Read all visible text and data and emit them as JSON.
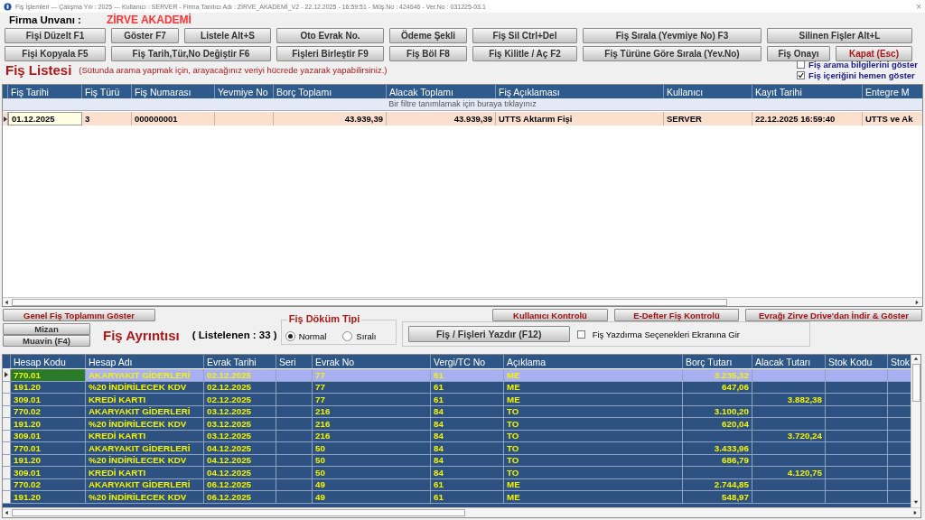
{
  "window": {
    "title": "Fiş İşlemleri  ---  Çalışma Yılı : 2025  ---  Kullanıcı : SERVER - Firma Tanıtıcı Adı : ZİRVE_AKADEMİ_V2 - 22.12.2025 - 16:59:51 - Müş.No : 424646 - Ver.No : 031225-03.1",
    "close": "×"
  },
  "firm": {
    "label": "Firma  Unvanı :",
    "value": "ZİRVE AKADEMİ"
  },
  "toolbar": [
    {
      "label": "Fişi Düzelt F1",
      "kind": "normal"
    },
    {
      "label": "Göster F7",
      "kind": "normal"
    },
    {
      "label": "Listele Alt+S",
      "kind": "normal"
    },
    {
      "label": "Oto Evrak No.",
      "kind": "normal"
    },
    {
      "label": "Ödeme Şekli",
      "kind": "normal"
    },
    {
      "label": "Fiş Sil Ctrl+Del",
      "kind": "normal"
    },
    {
      "label": "Fiş Sırala (Yevmiye No) F3",
      "kind": "normal"
    },
    {
      "label": "Silinen Fişler Alt+L",
      "kind": "normal"
    },
    {
      "label": "Fişi Kopyala F5",
      "kind": "normal"
    },
    {
      "label": "Fiş Tarih,Tür,No Değiştir F6",
      "kind": "normal"
    },
    {
      "label": "Fişleri Birleştir F9",
      "kind": "normal"
    },
    {
      "label": "Fiş Böl F8",
      "kind": "normal"
    },
    {
      "label": "Fiş Kilitle / Aç F2",
      "kind": "normal"
    },
    {
      "label": "Fiş Türüne Göre Sırala (Yev.No)",
      "kind": "normal"
    },
    {
      "label": "Fiş Onayı",
      "kind": "normal"
    },
    {
      "label": "Kapat (Esc)",
      "kind": "close"
    }
  ],
  "list_section": {
    "title": "Fiş Listesi",
    "hint": "(Sütunda arama yapmak için, arayacağınız veriyi hücrede yazarak yapabilirsiniz.)",
    "options": [
      {
        "label": "Fiş arama bilgilerini göster",
        "checked": false
      },
      {
        "label": "Fiş içeriğini hemen göster",
        "checked": true
      }
    ]
  },
  "voucher_table": {
    "columns": [
      {
        "label": "Fiş Tarihi"
      },
      {
        "label": "Fiş Türü"
      },
      {
        "label": "Fiş Numarası"
      },
      {
        "label": "Yevmiye No"
      },
      {
        "label": "Borç Toplamı"
      },
      {
        "label": "Alacak Toplamı"
      },
      {
        "label": "Fiş Açıklaması"
      },
      {
        "label": "Kullanıcı"
      },
      {
        "label": "Kayıt Tarihi"
      },
      {
        "label": "Entegre M"
      }
    ],
    "filter_hint": "Bir filtre tanımlamak için buraya tıklayınız",
    "rows": [
      {
        "selected": true,
        "cells": [
          "01.12.2025",
          "3",
          "000000001",
          "",
          "43.939,39",
          "43.939,39",
          "UTTS Aktarım Fişi",
          "SERVER",
          "22.12.2025 16:59:40",
          "UTTS ve Ak"
        ]
      }
    ]
  },
  "detail_section": {
    "total_button": "Genel Fiş Toplamını Göster",
    "mizan_button": "Mizan",
    "muavin_button": "Muavin (F4)",
    "title": "Fiş Ayrıntısı",
    "count": "( Listelenen : 33 )",
    "print_type": {
      "title": "Fiş Döküm Tipi",
      "options": [
        {
          "label": "Normal",
          "selected": true
        },
        {
          "label": "Sıralı",
          "selected": false
        }
      ]
    },
    "print_button": "Fiş / Fişleri Yazdır (F12)",
    "print_options": {
      "label": "Fiş Yazdırma Seçenekleri Ekranına Gir",
      "checked": false
    },
    "right_buttons": [
      "Kullanıcı Kontrolü",
      "E-Defter Fiş Kontrolü",
      "Evrağı Zirve Drive'dan İndir & Göster"
    ]
  },
  "detail_table": {
    "columns": [
      {
        "label": "Hesap Kodu"
      },
      {
        "label": "Hesap Adı"
      },
      {
        "label": "Evrak Tarihi"
      },
      {
        "label": "Seri"
      },
      {
        "label": "Evrak No"
      },
      {
        "label": "Vergi/TC No"
      },
      {
        "label": "Açıklama"
      },
      {
        "label": "Borç Tutarı"
      },
      {
        "label": "Alacak Tutarı"
      },
      {
        "label": "Stok Kodu"
      },
      {
        "label": "Stok"
      }
    ],
    "rows": [
      {
        "selected": true,
        "cells": [
          "770.01",
          "AKARYAKIT GİDERLERİ",
          "02.12.2025",
          "",
          "77",
          "61",
          "ME",
          "3.235,32",
          "",
          "",
          ""
        ]
      },
      {
        "selected": false,
        "cells": [
          "191.20",
          "%20 İNDİRİLECEK KDV",
          "02.12.2025",
          "",
          "77",
          "61",
          "ME",
          "647,06",
          "",
          "",
          ""
        ]
      },
      {
        "selected": false,
        "cells": [
          "309.01",
          "KREDİ KARTI",
          "02.12.2025",
          "",
          "77",
          "61",
          "ME",
          "",
          "3.882,38",
          "",
          ""
        ]
      },
      {
        "selected": false,
        "cells": [
          "770.02",
          "AKARYAKIT GİDERLERİ",
          "03.12.2025",
          "",
          "216",
          "84",
          "TO",
          "3.100,20",
          "",
          "",
          ""
        ]
      },
      {
        "selected": false,
        "cells": [
          "191.20",
          "%20 İNDİRİLECEK KDV",
          "03.12.2025",
          "",
          "216",
          "84",
          "TO",
          "620,04",
          "",
          "",
          ""
        ]
      },
      {
        "selected": false,
        "cells": [
          "309.01",
          "KREDİ KARTI",
          "03.12.2025",
          "",
          "216",
          "84",
          "TO",
          "",
          "3.720,24",
          "",
          ""
        ]
      },
      {
        "selected": false,
        "cells": [
          "770.01",
          "AKARYAKIT GİDERLERİ",
          "04.12.2025",
          "",
          "50",
          "84",
          "TO",
          "3.433,96",
          "",
          "",
          ""
        ]
      },
      {
        "selected": false,
        "cells": [
          "191.20",
          "%20 İNDİRİLECEK KDV",
          "04.12.2025",
          "",
          "50",
          "84",
          "TO",
          "686,79",
          "",
          "",
          ""
        ]
      },
      {
        "selected": false,
        "cells": [
          "309.01",
          "KREDİ KARTI",
          "04.12.2025",
          "",
          "50",
          "84",
          "TO",
          "",
          "4.120,75",
          "",
          ""
        ]
      },
      {
        "selected": false,
        "cells": [
          "770.02",
          "AKARYAKIT GİDERLERİ",
          "06.12.2025",
          "",
          "49",
          "61",
          "ME",
          "2.744,85",
          "",
          "",
          ""
        ]
      },
      {
        "selected": false,
        "cells": [
          "191.20",
          "%20 İNDİRİLECEK KDV",
          "06.12.2025",
          "",
          "49",
          "61",
          "ME",
          "548,97",
          "",
          "",
          ""
        ]
      }
    ]
  }
}
